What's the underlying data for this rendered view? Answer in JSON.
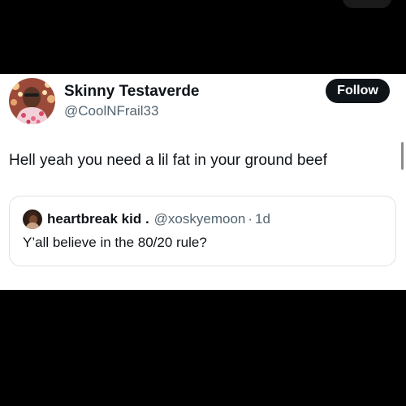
{
  "author": {
    "display_name": "Skinny Testaverde",
    "handle": "@CoolNFrail33"
  },
  "follow_button": {
    "label": "Follow"
  },
  "post": {
    "text": "Hell yeah you need a lil fat in your ground beef"
  },
  "quoted_post": {
    "display_name": "heartbreak kid .",
    "handle": "@xoskyemoon",
    "separator": "·",
    "time": "1d",
    "text": "Y’all believe in the 80/20 rule?"
  },
  "colors": {
    "background": "#000000",
    "card": "#ffffff",
    "primary_text": "#0f1419",
    "secondary_text": "#536471",
    "follow_button_bg": "#0f1419",
    "quote_border": "#dfe3e6"
  },
  "icons": {
    "author_avatar": "avatar-image",
    "quoted_avatar": "avatar-image"
  }
}
